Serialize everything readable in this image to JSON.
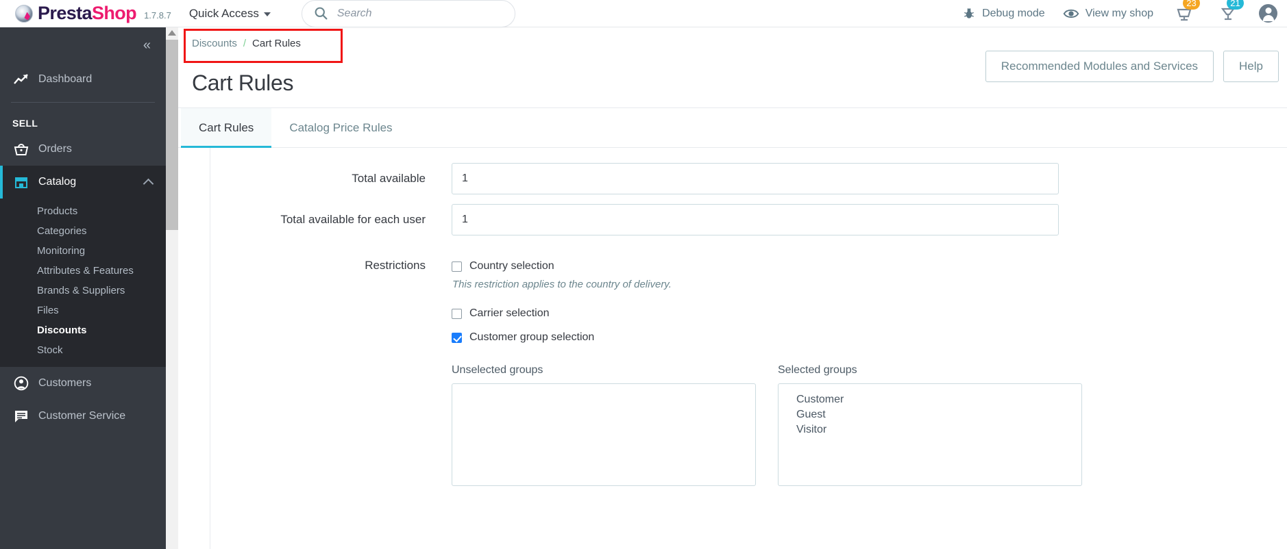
{
  "header": {
    "brand_presta": "Presta",
    "brand_shop": "Shop",
    "version": "1.7.8.7",
    "quick_access": "Quick Access",
    "search_placeholder": "Search",
    "search_value": "",
    "debug_mode": "Debug mode",
    "view_my_shop": "View my shop",
    "orders_badge": "23",
    "customers_badge": "21"
  },
  "sidebar": {
    "collapse_glyph": "«",
    "dashboard": "Dashboard",
    "section_sell": "SELL",
    "orders": "Orders",
    "catalog": "Catalog",
    "catalog_children": [
      "Products",
      "Categories",
      "Monitoring",
      "Attributes & Features",
      "Brands & Suppliers",
      "Files",
      "Discounts",
      "Stock"
    ],
    "active_child": "Discounts",
    "customers": "Customers",
    "customer_service": "Customer Service"
  },
  "page": {
    "breadcrumb_parent": "Discounts",
    "breadcrumb_sep": "/",
    "breadcrumb_current": "Cart Rules",
    "title": "Cart Rules",
    "btn_recommended": "Recommended Modules and Services",
    "btn_help": "Help"
  },
  "tabs": [
    {
      "label": "Cart Rules",
      "active": true
    },
    {
      "label": "Catalog Price Rules",
      "active": false
    }
  ],
  "form": {
    "total_available_label": "Total available",
    "total_available_value": "1",
    "total_available_each_user_label": "Total available for each user",
    "total_available_each_user_value": "1",
    "restrictions_label": "Restrictions",
    "country_selection": "Country selection",
    "country_help": "This restriction applies to the country of delivery.",
    "carrier_selection": "Carrier selection",
    "customer_group_selection": "Customer group selection",
    "unselected_groups_title": "Unselected groups",
    "selected_groups_title": "Selected groups",
    "unselected_groups": [],
    "selected_groups": [
      "Customer",
      "Guest",
      "Visitor"
    ]
  },
  "colors": {
    "accent": "#25b9d7",
    "brand_pink": "#ed1c6f",
    "sidebar_bg": "#363a41",
    "highlight_red": "#f01616",
    "checkbox_blue": "#1a7dfc"
  }
}
